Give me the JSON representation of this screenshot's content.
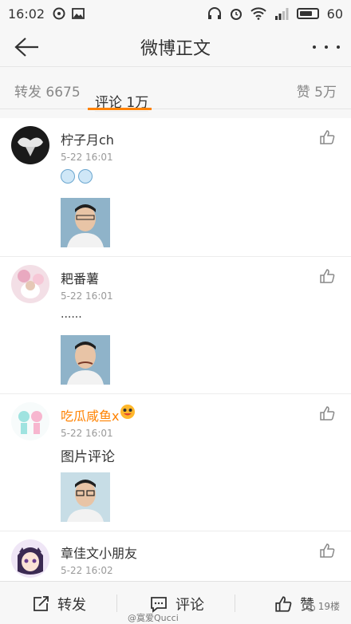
{
  "status_bar": {
    "time": "16:02",
    "battery": "60"
  },
  "nav": {
    "title": "微博正文"
  },
  "tabs": {
    "repost": "转发 6675",
    "comment": "评论 1万",
    "like": "赞 5万"
  },
  "comments": [
    {
      "username": "柠子月ch",
      "time": "5-22 16:01",
      "has_emoji": true,
      "text": ""
    },
    {
      "username": "耙番薯",
      "time": "5-22 16:01",
      "has_emoji": false,
      "text": "......"
    },
    {
      "username": "吃瓜咸鱼x",
      "time": "5-22 16:01",
      "has_emoji": false,
      "text": "图片评论"
    },
    {
      "username": "章佳文小朋友",
      "time": "5-22 16:02",
      "has_emoji": false,
      "text": ""
    }
  ],
  "bottom_bar": {
    "repost": "转发",
    "comment": "评论",
    "like": "赞"
  },
  "watermark": {
    "floor": "19楼",
    "account": "@寞爱Qucci"
  },
  "colors": {
    "accent": "#ff8200",
    "username_special": "#ff8200"
  }
}
